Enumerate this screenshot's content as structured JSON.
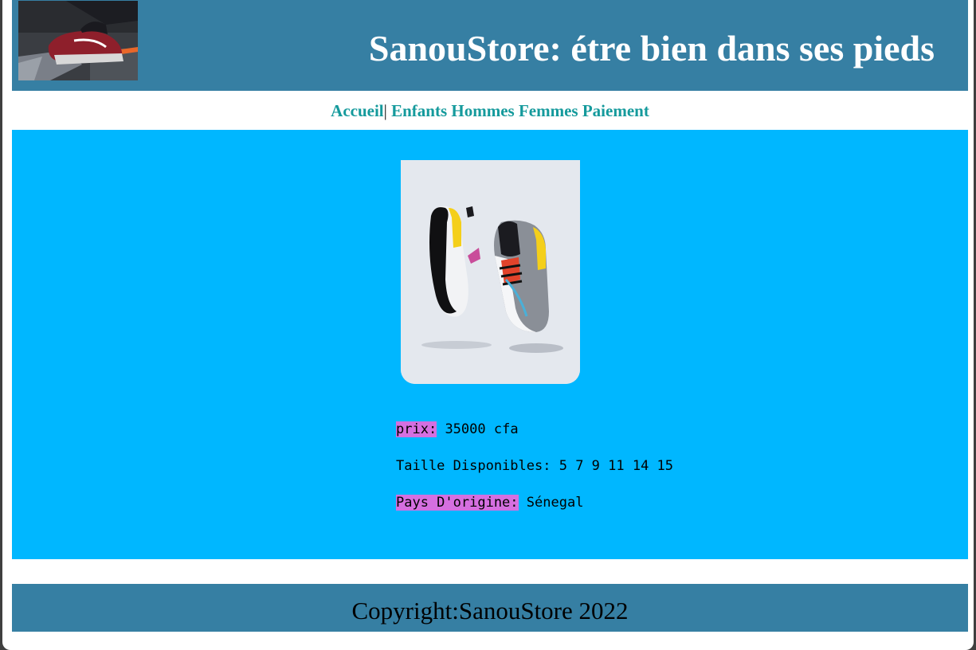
{
  "header": {
    "title": "SanouStore: étre bien dans ses pieds"
  },
  "nav": {
    "home": "Accueil",
    "separator": "|",
    "items": [
      "Enfants",
      "Hommes",
      "Femmes",
      "Paiement"
    ]
  },
  "product": {
    "price_label": "prix:",
    "price_value": "35000 cfa",
    "sizes_label": "Taille Disponibles:",
    "sizes_value": "5 7 9 11 14 15",
    "origin_label": "Pays D'origine:",
    "origin_value": "Sénegal"
  },
  "footer": {
    "copyright": "Copyright:SanouStore 2022"
  },
  "colors": {
    "header_bg": "#367fa3",
    "content_bg": "#00b7ff",
    "nav_link": "#159a9c",
    "label_highlight": "#d56fe0"
  }
}
